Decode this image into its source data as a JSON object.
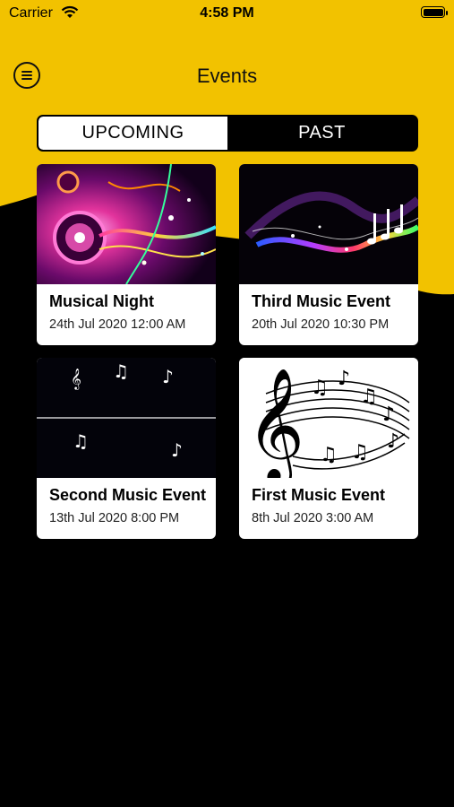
{
  "status_bar": {
    "carrier": "Carrier",
    "time": "4:58 PM"
  },
  "header": {
    "title": "Events",
    "menu_icon": "menu-icon"
  },
  "tabs": [
    {
      "label": "UPCOMING",
      "selected": true
    },
    {
      "label": "PAST",
      "selected": false
    }
  ],
  "events": [
    {
      "name": "Musical Night",
      "date": "24th Jul 2020 12:00 AM",
      "image": "neon-speaker"
    },
    {
      "name": "Third Music Event",
      "date": "20th Jul 2020 10:30 PM",
      "image": "rainbow-notes"
    },
    {
      "name": "Second Music Event",
      "date": "13th Jul 2020 8:00 PM",
      "image": "sound-wave"
    },
    {
      "name": "First Music Event",
      "date": "8th Jul 2020 3:00 AM",
      "image": "treble-clef-notes"
    }
  ],
  "colors": {
    "accent": "#F2C200",
    "background": "#000000",
    "card": "#FFFFFF"
  }
}
